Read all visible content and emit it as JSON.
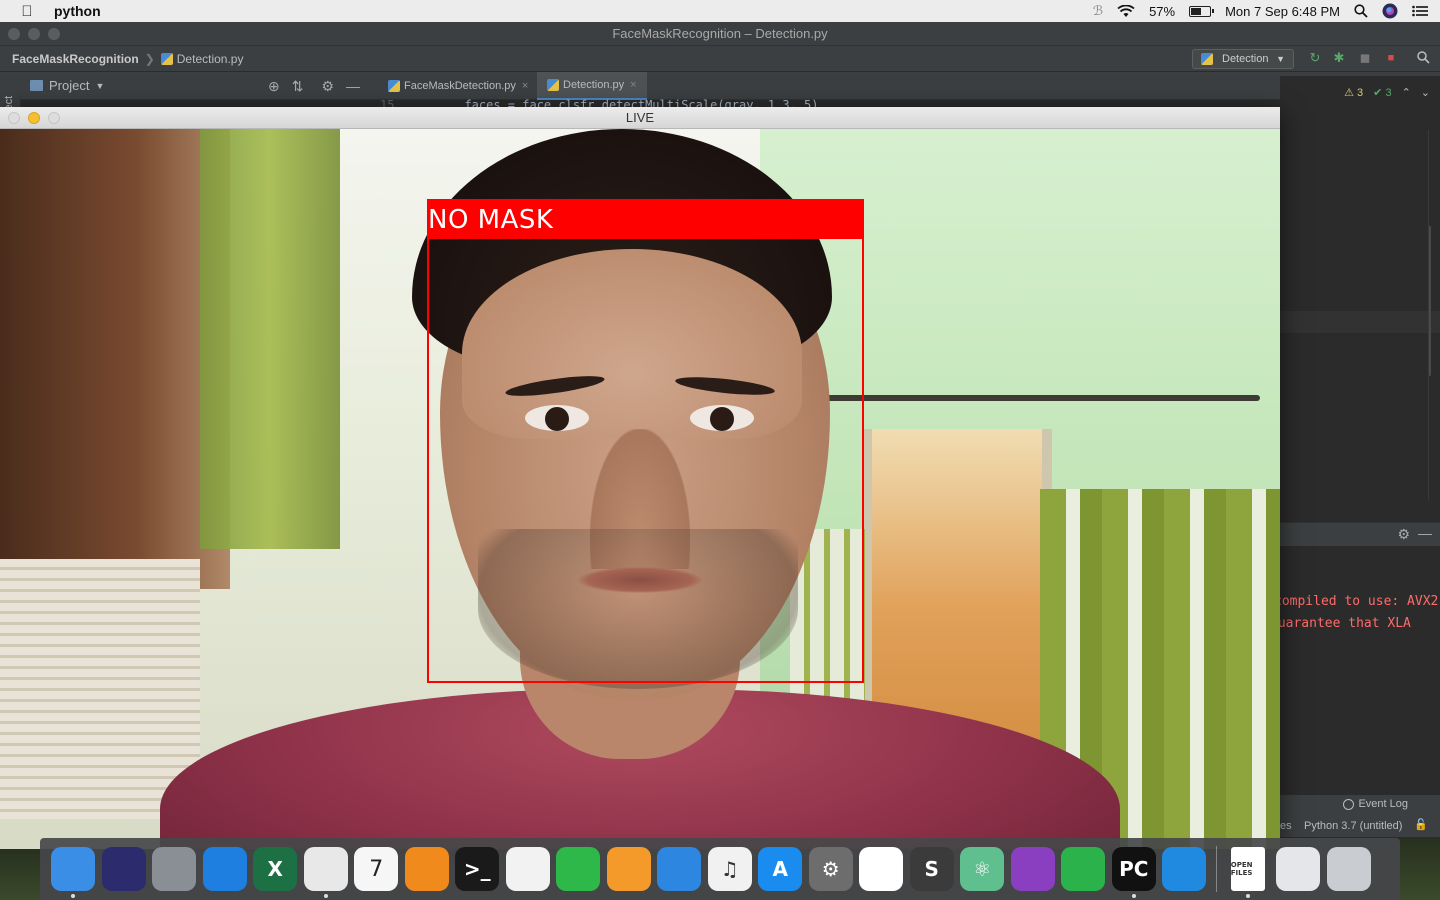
{
  "menubar": {
    "app_name": "python",
    "battery_percent": "57%",
    "battery_level": 0.57,
    "clock": "Mon 7 Sep  6:48 PM"
  },
  "ide": {
    "window_title": "FaceMaskRecognition – Detection.py",
    "breadcrumb_project": "FaceMaskRecognition",
    "breadcrumb_file": "Detection.py",
    "run_config": "Detection",
    "side_tab": "Project",
    "project_panel_label": "Project",
    "tabs": [
      {
        "label": "FaceMaskDetection.py",
        "active": false
      },
      {
        "label": "Detection.py",
        "active": true
      }
    ],
    "code_line_number": "15",
    "code_line": "faces = face_clsfr.detectMultiScale(gray, 1.3, 5)",
    "warnings_count": "3",
    "ok_count": "3",
    "console_lines": [
      "compiled to use: AVX2",
      "guarantee that XLA"
    ],
    "event_log": "Event Log",
    "status_left": "es",
    "interpreter": "Python 3.7 (untitled)"
  },
  "live_window": {
    "title": "LIVE",
    "detection_label": "NO MASK",
    "detection_color": "#ff0000"
  },
  "dock": {
    "items": [
      {
        "name": "finder-icon",
        "glyph": "",
        "bg": "#3a8ee6",
        "running": true
      },
      {
        "name": "siri-icon",
        "glyph": "",
        "bg": "#2b2b6e",
        "running": false
      },
      {
        "name": "launchpad-icon",
        "glyph": "",
        "bg": "#8a8f96",
        "running": false
      },
      {
        "name": "safari-icon",
        "glyph": "",
        "bg": "#1f7fe0",
        "running": false
      },
      {
        "name": "excel-icon",
        "glyph": "X",
        "bg": "#1d7044",
        "running": false
      },
      {
        "name": "chrome-icon",
        "glyph": "",
        "bg": "#e8e8e8",
        "running": true
      },
      {
        "name": "calendar-icon",
        "glyph": "7",
        "bg": "#f6f6f6",
        "running": false
      },
      {
        "name": "vlc-icon",
        "glyph": "",
        "bg": "#f08a1c",
        "running": false
      },
      {
        "name": "terminal-icon",
        "glyph": ">_",
        "bg": "#1a1a1a",
        "running": false
      },
      {
        "name": "photos-icon",
        "glyph": "",
        "bg": "#f2f2f2",
        "running": false
      },
      {
        "name": "facetime-icon",
        "glyph": "",
        "bg": "#2fb84a",
        "running": false
      },
      {
        "name": "pages-icon",
        "glyph": "",
        "bg": "#f39a2a",
        "running": false
      },
      {
        "name": "keynote-icon",
        "glyph": "",
        "bg": "#2d86e0",
        "running": false
      },
      {
        "name": "itunes-icon",
        "glyph": "♫",
        "bg": "#f1f1f1",
        "running": false
      },
      {
        "name": "app-store-icon",
        "glyph": "A",
        "bg": "#1a8cf0",
        "running": false
      },
      {
        "name": "system-preferences-icon",
        "glyph": "⚙",
        "bg": "#6d6d6d",
        "running": false
      },
      {
        "name": "mongodb-compass-icon",
        "glyph": "",
        "bg": "#ffffff",
        "running": false
      },
      {
        "name": "sublime-text-icon",
        "glyph": "S",
        "bg": "#3b3b3b",
        "running": false
      },
      {
        "name": "atom-icon",
        "glyph": "⚛",
        "bg": "#5fbf8f",
        "running": false
      },
      {
        "name": "github-desktop-icon",
        "glyph": "",
        "bg": "#8a3fc0",
        "running": false
      },
      {
        "name": "anaconda-icon",
        "glyph": "",
        "bg": "#2bb24a",
        "running": false
      },
      {
        "name": "pycharm-icon",
        "glyph": "PC",
        "bg": "#111111",
        "running": true
      },
      {
        "name": "vscode-icon",
        "glyph": "",
        "bg": "#1f8ae0",
        "running": false
      }
    ],
    "right_items": [
      {
        "name": "open-files-icon",
        "glyph": "OPEN FILES",
        "bg": "#ffffff",
        "running": true
      },
      {
        "name": "screenshot-folder-icon",
        "glyph": "",
        "bg": "#e4e6ea",
        "running": false
      },
      {
        "name": "trash-icon",
        "glyph": "",
        "bg": "#c9ccd0",
        "running": false
      }
    ]
  }
}
